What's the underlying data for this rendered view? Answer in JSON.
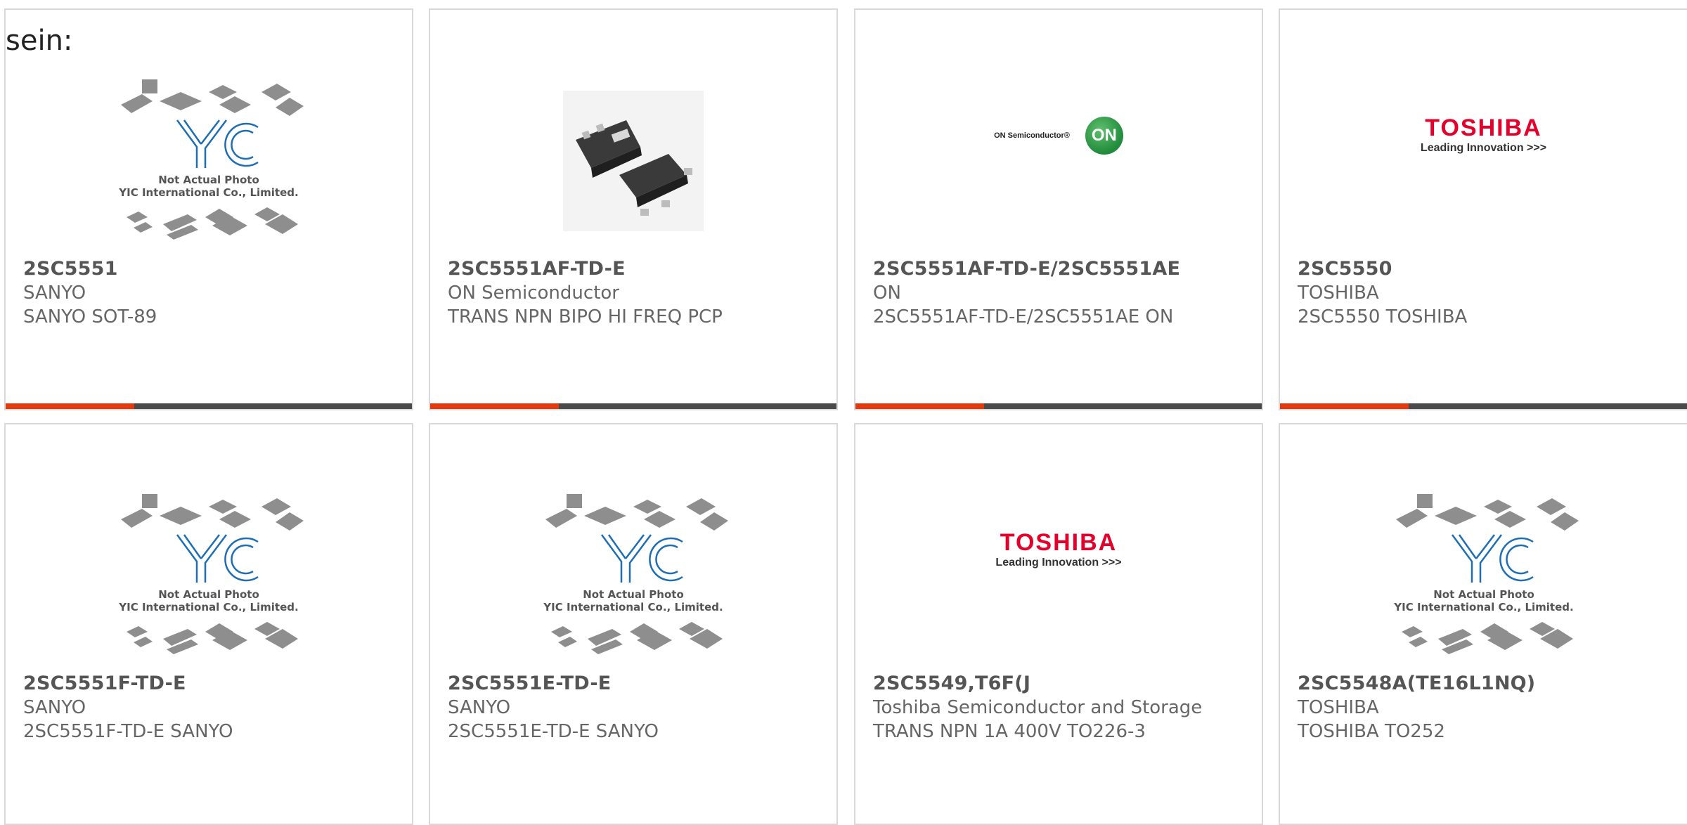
{
  "heading": "sein:",
  "colors": {
    "accent": "#e03a10",
    "bar": "#4a4a4a",
    "border": "#d9d9d9"
  },
  "placeholder": {
    "brand": "YIC",
    "line1": "Not Actual Photo",
    "line2": "YIC International Co., Limited."
  },
  "logos": {
    "toshiba_word": "TOSHIBA",
    "toshiba_tag": "Leading Innovation >>>",
    "on_word": "ON Semiconductor®",
    "on_mark": "ON"
  },
  "products": [
    {
      "part": "2SC5551",
      "maker": "SANYO",
      "desc": "SANYO SOT-89",
      "image": "yic-placeholder"
    },
    {
      "part": "2SC5551AF-TD-E",
      "maker": "ON Semiconductor",
      "desc": "TRANS NPN BIPO HI FREQ PCP",
      "image": "component-photo"
    },
    {
      "part": "2SC5551AF-TD-E/2SC5551AE",
      "maker": "ON",
      "desc": "2SC5551AF-TD-E/2SC5551AE ON",
      "image": "on-semiconductor-logo"
    },
    {
      "part": "2SC5550",
      "maker": "TOSHIBA",
      "desc": "2SC5550 TOSHIBA",
      "image": "toshiba-logo"
    },
    {
      "part": "2SC5551F-TD-E",
      "maker": "SANYO",
      "desc": "2SC5551F-TD-E SANYO",
      "image": "yic-placeholder"
    },
    {
      "part": "2SC5551E-TD-E",
      "maker": "SANYO",
      "desc": "2SC5551E-TD-E SANYO",
      "image": "yic-placeholder"
    },
    {
      "part": "2SC5549,T6F(J",
      "maker": "Toshiba Semiconductor and Storage",
      "desc": "TRANS NPN 1A 400V TO226-3",
      "image": "toshiba-logo"
    },
    {
      "part": "2SC5548A(TE16L1NQ)",
      "maker": "TOSHIBA",
      "desc": "TOSHIBA TO252",
      "image": "yic-placeholder"
    }
  ]
}
